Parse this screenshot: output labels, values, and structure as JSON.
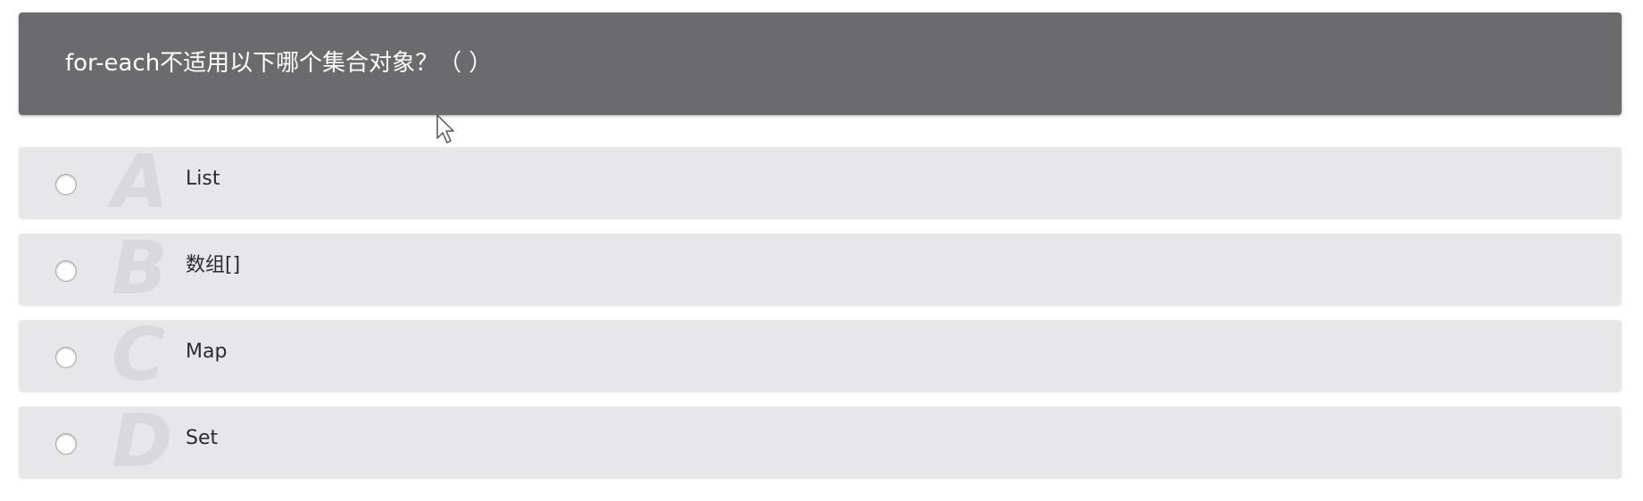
{
  "question": {
    "text": "for-each不适用以下哪个集合对象？（ ）"
  },
  "options": [
    {
      "letter": "A",
      "label": "List"
    },
    {
      "letter": "B",
      "label": "数组[]"
    },
    {
      "letter": "C",
      "label": "Map"
    },
    {
      "letter": "D",
      "label": "Set"
    }
  ],
  "colors": {
    "header_bg": "#6b6b6d",
    "option_bg": "#e7e6e9",
    "letter_watermark": "#d9d8db"
  },
  "icons": {
    "cursor": "mouse-pointer-icon",
    "radio": "radio-button"
  }
}
